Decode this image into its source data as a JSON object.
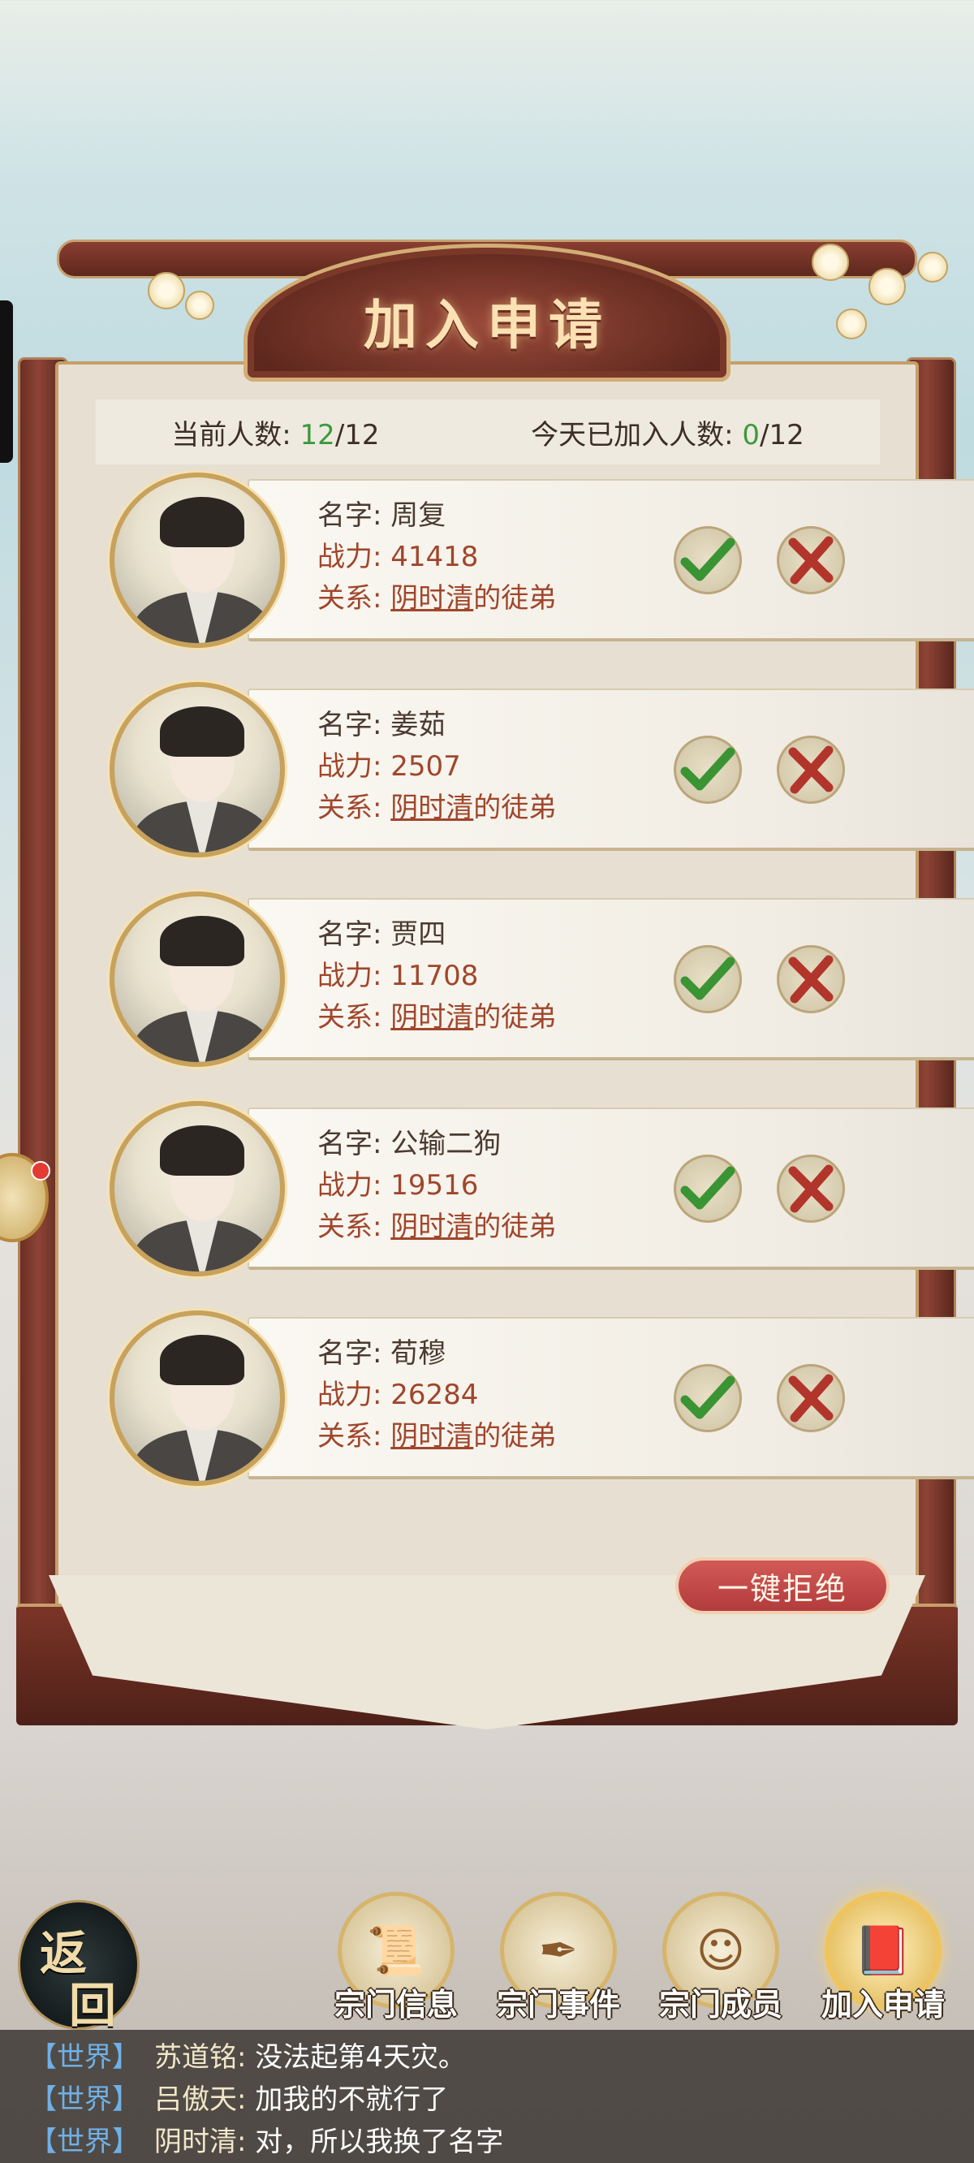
{
  "dialog": {
    "title": "加入申请"
  },
  "stats": {
    "current_label": "当前人数: ",
    "current_value": "12",
    "current_max": "/12",
    "joined_label": "今天已加入人数: ",
    "joined_value": "0",
    "joined_max": "/12"
  },
  "labels": {
    "name": "名字: ",
    "power": "战力: ",
    "relation": "关系: ",
    "relation_suffix": "的徒弟"
  },
  "applicants": [
    {
      "name": "周复",
      "power": "41418",
      "master": "阴时清"
    },
    {
      "name": "姜茹",
      "power": "2507",
      "master": "阴时清"
    },
    {
      "name": "贾四",
      "power": "11708",
      "master": "阴时清"
    },
    {
      "name": "公输二狗",
      "power": "19516",
      "master": "阴时清"
    },
    {
      "name": "荀穆",
      "power": "26284",
      "master": "阴时清"
    }
  ],
  "reject_all_label": "一键拒绝",
  "back_button": {
    "char1": "返",
    "char2": "回"
  },
  "nav": [
    {
      "label": "宗门信息",
      "icon": "scroll-icon"
    },
    {
      "label": "宗门事件",
      "icon": "event-icon"
    },
    {
      "label": "宗门成员",
      "icon": "members-icon"
    },
    {
      "label": "加入申请",
      "icon": "application-book-icon",
      "active": true
    }
  ],
  "chat": [
    {
      "channel": "【世界】",
      "sender": "苏道铭:",
      "message": " 没法起第4天灾。"
    },
    {
      "channel": "【世界】",
      "sender": "吕傲天:",
      "message": " 加我的不就行了"
    },
    {
      "channel": "【世界】",
      "sender": "阴时清:",
      "message": " 对，所以我换了名字"
    }
  ],
  "colors": {
    "accent_green": "#3c9a3c",
    "power_red": "#a0462c",
    "reject_red": "#c0474a",
    "chat_channel_blue": "#6fb0e6"
  }
}
